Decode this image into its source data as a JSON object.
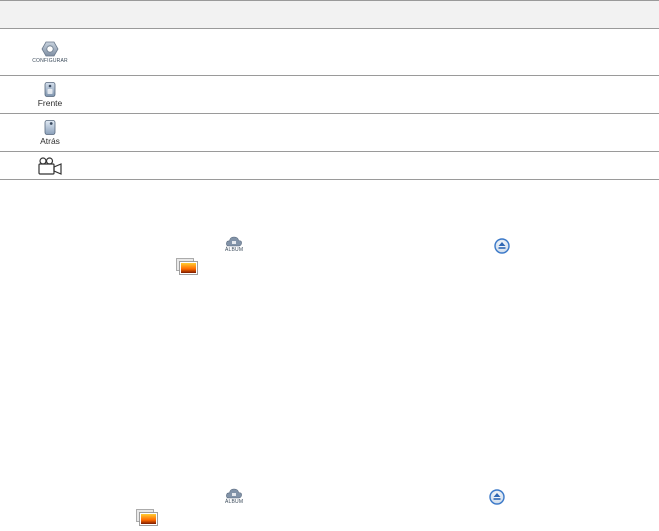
{
  "table": {
    "rows": [
      {
        "icon": "settings-gear-icon",
        "label": "CONFIGURAR"
      },
      {
        "icon": "front-camera-icon",
        "label": "Frente"
      },
      {
        "icon": "rear-camera-icon",
        "label": "Atrás"
      },
      {
        "icon": "video-camera-icon",
        "label": ""
      }
    ]
  },
  "panels": [
    {
      "album_label": "ÁLBUM",
      "album_icon": "album-cloud-icon",
      "eject_icon": "eject-icon",
      "gallery_icon": "photo-gallery-icon"
    },
    {
      "album_label": "ÁLBUM",
      "album_icon": "album-cloud-icon",
      "eject_icon": "eject-icon",
      "gallery_icon": "photo-gallery-icon"
    }
  ],
  "colors": {
    "border": "#9a9a9a",
    "header_bg": "#f2f2f2",
    "accent_blue": "#3a78c8"
  }
}
